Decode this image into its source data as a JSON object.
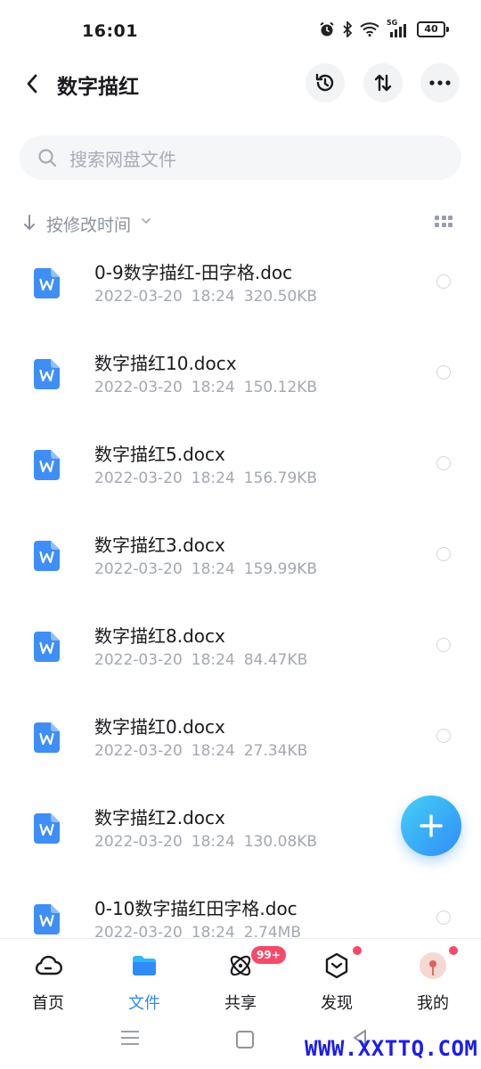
{
  "status": {
    "time": "16:01",
    "battery": "40",
    "network": "5G"
  },
  "header": {
    "title": "数字描红"
  },
  "search": {
    "placeholder": "搜索网盘文件"
  },
  "sort": {
    "label": "按修改时间"
  },
  "files": [
    {
      "name": "0-9数字描红-田字格.doc",
      "date": "2022-03-20",
      "time": "18:24",
      "size": "320.50KB"
    },
    {
      "name": "数字描红10.docx",
      "date": "2022-03-20",
      "time": "18:24",
      "size": "150.12KB"
    },
    {
      "name": "数字描红5.docx",
      "date": "2022-03-20",
      "time": "18:24",
      "size": "156.79KB"
    },
    {
      "name": "数字描红3.docx",
      "date": "2022-03-20",
      "time": "18:24",
      "size": "159.99KB"
    },
    {
      "name": "数字描红8.docx",
      "date": "2022-03-20",
      "time": "18:24",
      "size": "84.47KB"
    },
    {
      "name": "数字描红0.docx",
      "date": "2022-03-20",
      "time": "18:24",
      "size": "27.34KB"
    },
    {
      "name": "数字描红2.docx",
      "date": "2022-03-20",
      "time": "18:24",
      "size": "130.08KB"
    },
    {
      "name": "0-10数字描红田字格.doc",
      "date": "2022-03-20",
      "time": "18:24",
      "size": "2.74MB"
    }
  ],
  "tabs": [
    {
      "label": "首页",
      "icon": "cloud-icon"
    },
    {
      "label": "文件",
      "icon": "folder-icon"
    },
    {
      "label": "共享",
      "icon": "atom-icon",
      "badge": "99+"
    },
    {
      "label": "发现",
      "icon": "cube-icon"
    },
    {
      "label": "我的",
      "icon": "avatar"
    }
  ],
  "watermark": "WWW.XXTTQ.COM",
  "colors": {
    "accent": "#2f8cf7",
    "badge": "#f54a6a",
    "word_icon": "#3f8ef6"
  }
}
